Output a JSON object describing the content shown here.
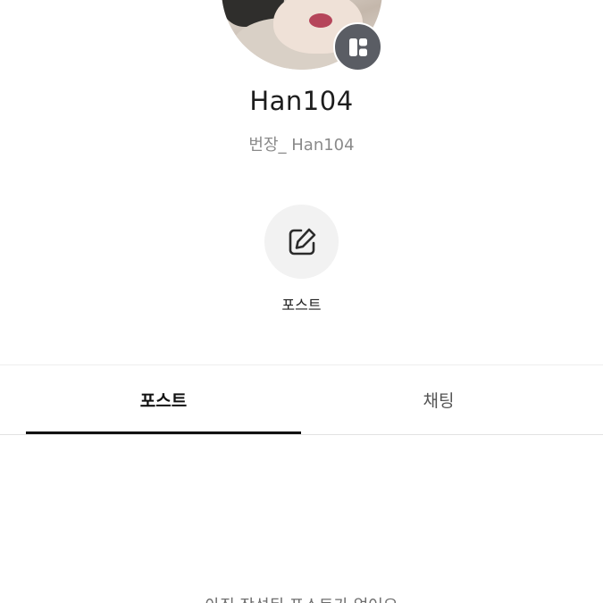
{
  "profile": {
    "username": "Han104",
    "handle": "번장_ Han104",
    "avatar_badge_icon": "layout-grid-icon"
  },
  "actions": {
    "post": {
      "icon": "edit-icon",
      "label": "포스트"
    }
  },
  "tabs": [
    {
      "label": "포스트",
      "selected": true
    },
    {
      "label": "채팅",
      "selected": false
    }
  ],
  "empty_state": {
    "text": "아직 작성된 포스트가 없어요"
  },
  "colors": {
    "badge": "#5a5d64",
    "action_bg": "#f2f2f2",
    "indicator": "#111111",
    "muted_text": "#8a8a8a"
  }
}
